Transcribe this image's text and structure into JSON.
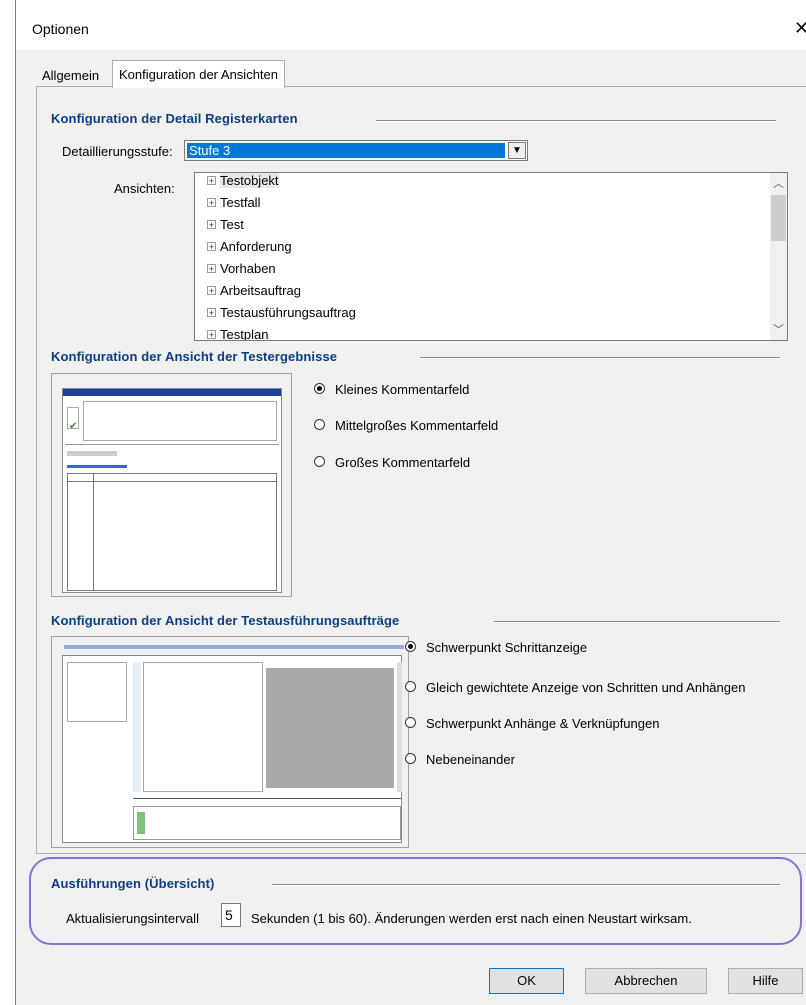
{
  "window": {
    "title": "Optionen",
    "close_glyph": "✕"
  },
  "tabs": [
    {
      "label": "Allgemein",
      "active": false
    },
    {
      "label": "Konfiguration der Ansichten",
      "active": true
    }
  ],
  "detail_section": {
    "title": "Konfiguration der Detail Registerkarten",
    "level_label": "Detaillierungsstufe:",
    "level_value": "Stufe 3",
    "views_label": "Ansichten:",
    "views": [
      "Testobjekt",
      "Testfall",
      "Test",
      "Anforderung",
      "Vorhaben",
      "Arbeitsauftrag",
      "Testausführungsauftrag",
      "Testplan"
    ]
  },
  "results_section": {
    "title": "Konfiguration der Ansicht der Testergebnisse",
    "options": [
      {
        "label": "Kleines Kommentarfeld",
        "selected": true
      },
      {
        "label": "Mittelgroßes Kommentarfeld",
        "selected": false
      },
      {
        "label": "Großes Kommentarfeld",
        "selected": false
      }
    ]
  },
  "orders_section": {
    "title": "Konfiguration der Ansicht der Testausführungsaufträge",
    "options": [
      {
        "label": "Schwerpunkt Schrittanzeige",
        "selected": true
      },
      {
        "label": "Gleich gewichtete Anzeige von Schritten und Anhängen",
        "selected": false
      },
      {
        "label": "Schwerpunkt Anhänge & Verknüpfungen",
        "selected": false
      },
      {
        "label": "Nebeneinander",
        "selected": false
      }
    ]
  },
  "overview_section": {
    "title": "Ausführungen (Übersicht)",
    "interval_label": "Aktualisierungsintervall",
    "interval_value": "5",
    "interval_hint": "Sekunden (1 bis 60). Änderungen werden erst nach einen Neustart wirksam."
  },
  "buttons": {
    "ok": "OK",
    "cancel": "Abbrechen",
    "help": "Hilfe"
  },
  "colors": {
    "group_title": "#0b3f82",
    "selection": "#0078d7",
    "highlight_outline": "#8a6fd1"
  }
}
